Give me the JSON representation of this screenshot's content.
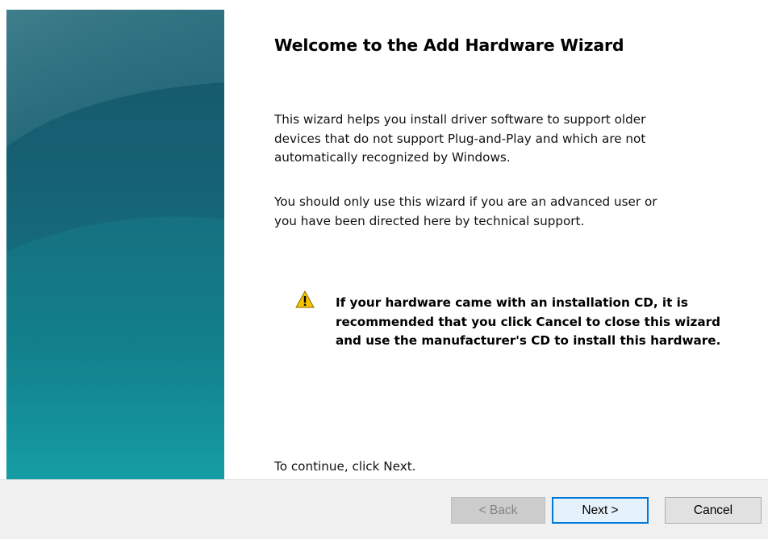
{
  "wizard": {
    "title": "Welcome to the Add Hardware Wizard",
    "intro_lines": [
      "This wizard helps you install driver software to support older",
      "devices that do not support Plug-and-Play and which are not",
      "automatically recognized by Windows."
    ],
    "advice_lines": [
      "You should only use this wizard if you are an advanced user or",
      "you have been directed here by technical support."
    ],
    "warning": {
      "icon": "warning-icon",
      "lines": [
        "If your hardware came with an installation CD, it is",
        "recommended that you click Cancel to close this wizard",
        "and use the manufacturer's CD to install this hardware."
      ]
    },
    "continue_text": "To continue, click Next."
  },
  "buttons": {
    "back": "< Back",
    "next": "Next >",
    "cancel": "Cancel"
  },
  "colors": {
    "banner_top": "#2f6f7f",
    "banner_bottom": "#16a0a6",
    "focus_border": "#0078d7",
    "warning_yellow": "#f5c400"
  }
}
